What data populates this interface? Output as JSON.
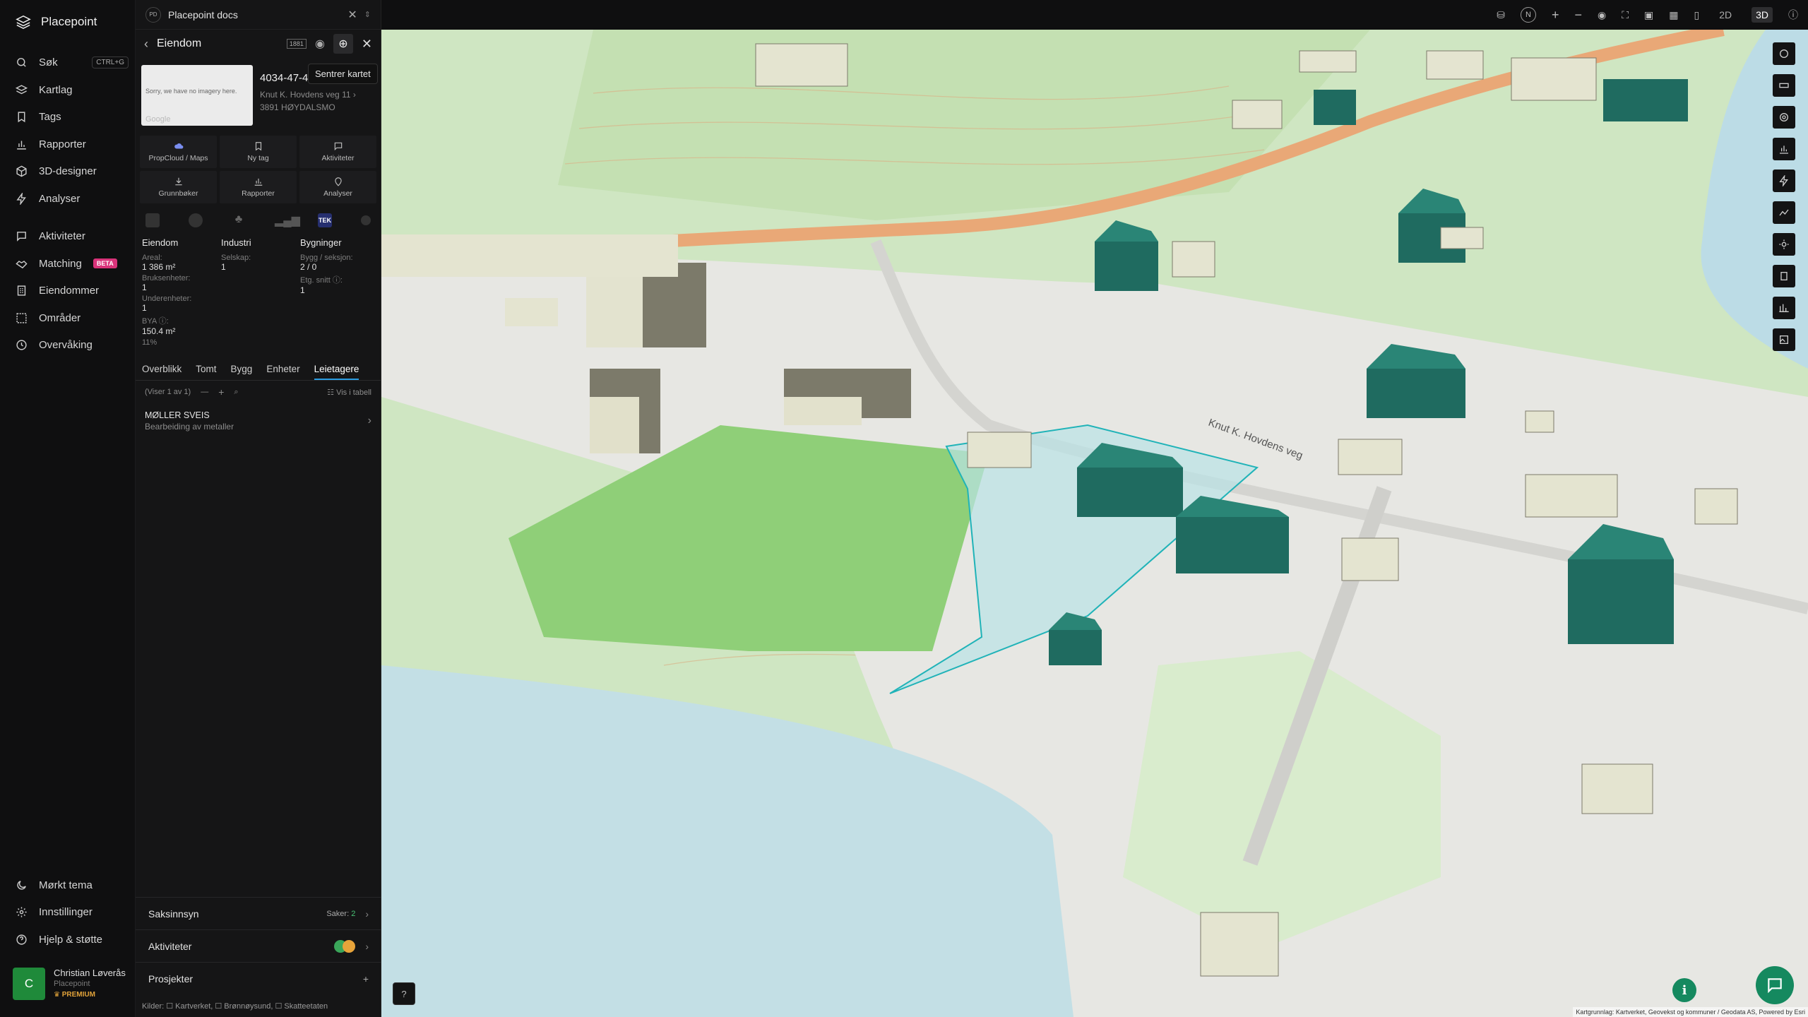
{
  "nav": {
    "brand": "Placepoint",
    "items": [
      {
        "label": "Søk",
        "kbd": "CTRL+G"
      },
      {
        "label": "Kartlag"
      },
      {
        "label": "Tags"
      },
      {
        "label": "Rapporter"
      },
      {
        "label": "3D-designer"
      },
      {
        "label": "Analyser"
      },
      {
        "label": "Aktiviteter"
      },
      {
        "label": "Matching",
        "badge": "BETA"
      },
      {
        "label": "Eiendommer"
      },
      {
        "label": "Områder"
      },
      {
        "label": "Overvåking"
      }
    ],
    "bottom": [
      {
        "label": "Mørkt tema"
      },
      {
        "label": "Innstillinger"
      },
      {
        "label": "Hjelp & støtte"
      }
    ],
    "user": {
      "initial": "C",
      "name": "Christian Løverås",
      "org": "Placepoint",
      "plan": "PREMIUM"
    }
  },
  "doc_bar": {
    "badge": "PD",
    "title": "Placepoint docs"
  },
  "property": {
    "header": "Eiendom",
    "tooltip": "Sentrer kartet",
    "thumb_text": "Sorry, we have no imagery here.",
    "thumb_brand": "Google",
    "id": "4034-47-48-0-0",
    "address": "Knut K. Hovdens veg 11",
    "postal": "3891 HØYDALSMO",
    "actions": [
      {
        "label": "PropCloud / Maps"
      },
      {
        "label": "Ny tag"
      },
      {
        "label": "Aktiviteter"
      },
      {
        "label": "Grunnbøker"
      },
      {
        "label": "Rapporter"
      },
      {
        "label": "Analyser"
      }
    ],
    "source_badge": "TEK",
    "facts": {
      "col1": {
        "title": "Eiendom",
        "areal_l": "Areal:",
        "areal_v": "1 386 m²",
        "bruk_l": "Bruksenheter:",
        "bruk_v": "1",
        "under_l": "Underenheter:",
        "under_v": "1",
        "bya_l": "BYA ⓘ:",
        "bya_v": "150.4 m²",
        "bya_p": "11%"
      },
      "col2": {
        "title": "Industri",
        "sel_l": "Selskap:",
        "sel_v": "1"
      },
      "col3": {
        "title": "Bygninger",
        "bygg_l": "Bygg / seksjon:",
        "bygg_v": "2 / 0",
        "etg_l": "Etg. snitt ⓘ:",
        "etg_v": "1"
      }
    },
    "tabs": [
      "Overblikk",
      "Tomt",
      "Bygg",
      "Enheter",
      "Leietagere"
    ],
    "list_info": "(Viser 1 av 1)",
    "table_label": "Vis i tabell",
    "tenant": {
      "name": "MØLLER SVEIS",
      "desc": "Bearbeiding av metaller"
    },
    "sections": {
      "saks": "Saksinnsyn",
      "saker_l": "Saker:",
      "saker_v": "2",
      "akt": "Aktiviteter",
      "prosj": "Prosjekter"
    },
    "sources": "Kilder: ☐ Kartverket, ☐ Brønnøysund, ☐ Skatteetaten"
  },
  "map": {
    "view_2d": "2D",
    "view_3d": "3D",
    "north": "N",
    "road_label": "Knut K. Hovdens veg",
    "credit": "Kartgrunnlag: Kartverket, Geovekst og kommuner / Geodata AS, Powered by Esri",
    "colors": {
      "grass": "#cbe4bf",
      "water": "#c4dfe6",
      "road": "#e8a16e",
      "building_sel": "#1f6b60",
      "building": "#7c7a6a"
    }
  }
}
